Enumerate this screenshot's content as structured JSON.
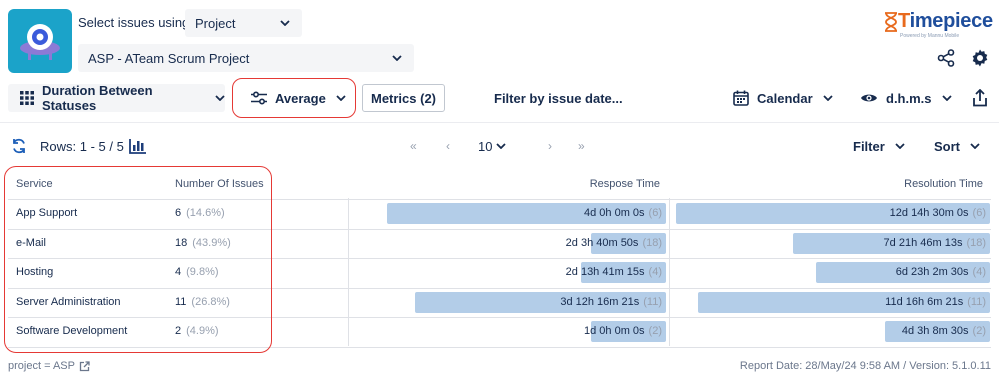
{
  "header": {
    "select_label": "Select issues using",
    "select_type": "Project",
    "project": "ASP - ATeam Scrum Project",
    "logo_text_first": "T",
    "logo_text_rest": "imepiece",
    "logo_sub": "Powered by Mannu Mobile"
  },
  "toolbar": {
    "duration": "Duration Between Statuses",
    "average": "Average",
    "metrics": "Metrics (2)",
    "filter_date": "Filter by issue date...",
    "calendar": "Calendar",
    "format": "d.h.m.s"
  },
  "rows_bar": {
    "rows_label": "Rows: 1 - 5 / 5",
    "page_size": "10",
    "filter": "Filter",
    "sort": "Sort"
  },
  "table": {
    "headers": {
      "service": "Service",
      "issues": "Number Of Issues",
      "response": "Respose Time",
      "resolution": "Resolution Time"
    },
    "rows": [
      {
        "service": "App Support",
        "count": "6",
        "pct": "(14.6%)",
        "response": "4d 0h 0m 0s",
        "response_n": "(6)",
        "resolution": "12d 14h 30m 0s",
        "resolution_n": "(6)",
        "response_frac": 0.89,
        "resolution_frac": 0.99
      },
      {
        "service": "e-Mail",
        "count": "18",
        "pct": "(43.9%)",
        "response": "2d 3h 40m 50s",
        "response_n": "(18)",
        "resolution": "7d 21h 46m 13s",
        "resolution_n": "(18)",
        "response_frac": 0.24,
        "resolution_frac": 0.62
      },
      {
        "service": "Hosting",
        "count": "4",
        "pct": "(9.8%)",
        "response": "2d 13h 41m 15s",
        "response_n": "(4)",
        "resolution": "6d 23h 2m 30s",
        "resolution_n": "(4)",
        "response_frac": 0.27,
        "resolution_frac": 0.55
      },
      {
        "service": "Server Administration",
        "count": "11",
        "pct": "(26.8%)",
        "response": "3d 12h 16m 21s",
        "response_n": "(11)",
        "resolution": "11d 16h 6m 21s",
        "resolution_n": "(11)",
        "response_frac": 0.8,
        "resolution_frac": 0.92
      },
      {
        "service": "Software Development",
        "count": "2",
        "pct": "(4.9%)",
        "response": "1d 0h 0m 0s",
        "response_n": "(2)",
        "resolution": "4d 3h 8m 30s",
        "resolution_n": "(2)",
        "response_frac": 0.24,
        "resolution_frac": 0.33
      }
    ]
  },
  "footer": {
    "query": "project = ASP",
    "report": "Report Date: 28/May/24 9:58 AM / Version: 5.1.0.11"
  },
  "colors": {
    "accent": "#e53935",
    "bar": "#b3cde8",
    "app_icon": "#1ba3c9"
  }
}
